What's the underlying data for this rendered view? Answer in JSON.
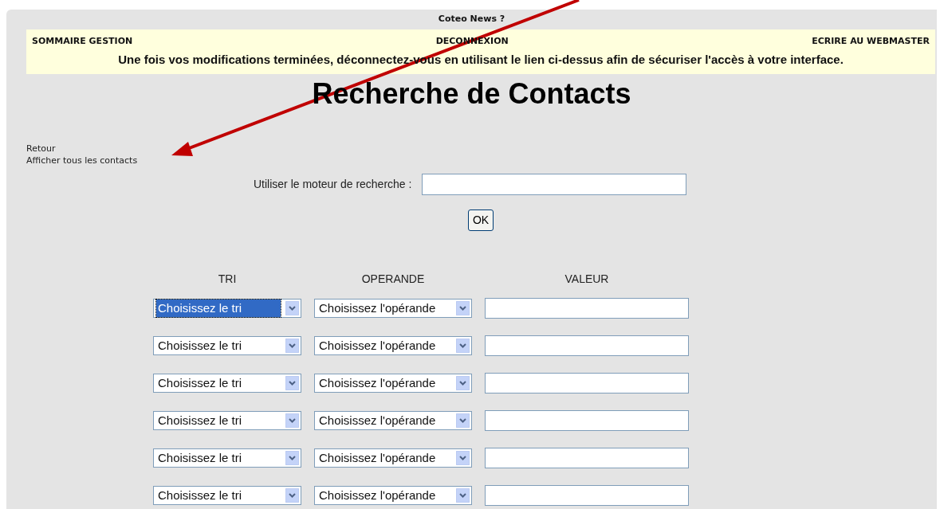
{
  "top_title": "Coteo News ?",
  "nav": [
    "SOMMAIRE GESTION",
    "DECONNEXION",
    "ECRIRE AU WEBMASTER"
  ],
  "notice": "Une fois vos modifications terminées, déconnectez-vous en utilisant le lien ci-dessus afin de sécuriser l'accès à votre interface.",
  "heading": "Recherche de Contacts",
  "links": [
    "Retour",
    "Afficher tous les contacts"
  ],
  "search": {
    "label": "Utiliser le moteur de recherche :",
    "button": "OK"
  },
  "criteria": {
    "columns": [
      "TRI",
      "OPERANDE",
      "VALEUR"
    ],
    "rows": [
      {
        "sort": "Choisissez le tri",
        "sort_focused": true,
        "operand": "Choisissez l'opérande"
      },
      {
        "sort": "Choisissez le tri",
        "sort_focused": false,
        "operand": "Choisissez l'opérande"
      },
      {
        "sort": "Choisissez le tri",
        "sort_focused": false,
        "operand": "Choisissez l'opérande"
      },
      {
        "sort": "Choisissez le tri",
        "sort_focused": false,
        "operand": "Choisissez l'opérande"
      },
      {
        "sort": "Choisissez le tri",
        "sort_focused": false,
        "operand": "Choisissez l'opérande"
      },
      {
        "sort": "Choisissez le tri",
        "sort_focused": false,
        "operand": "Choisissez l'opérande"
      }
    ]
  }
}
